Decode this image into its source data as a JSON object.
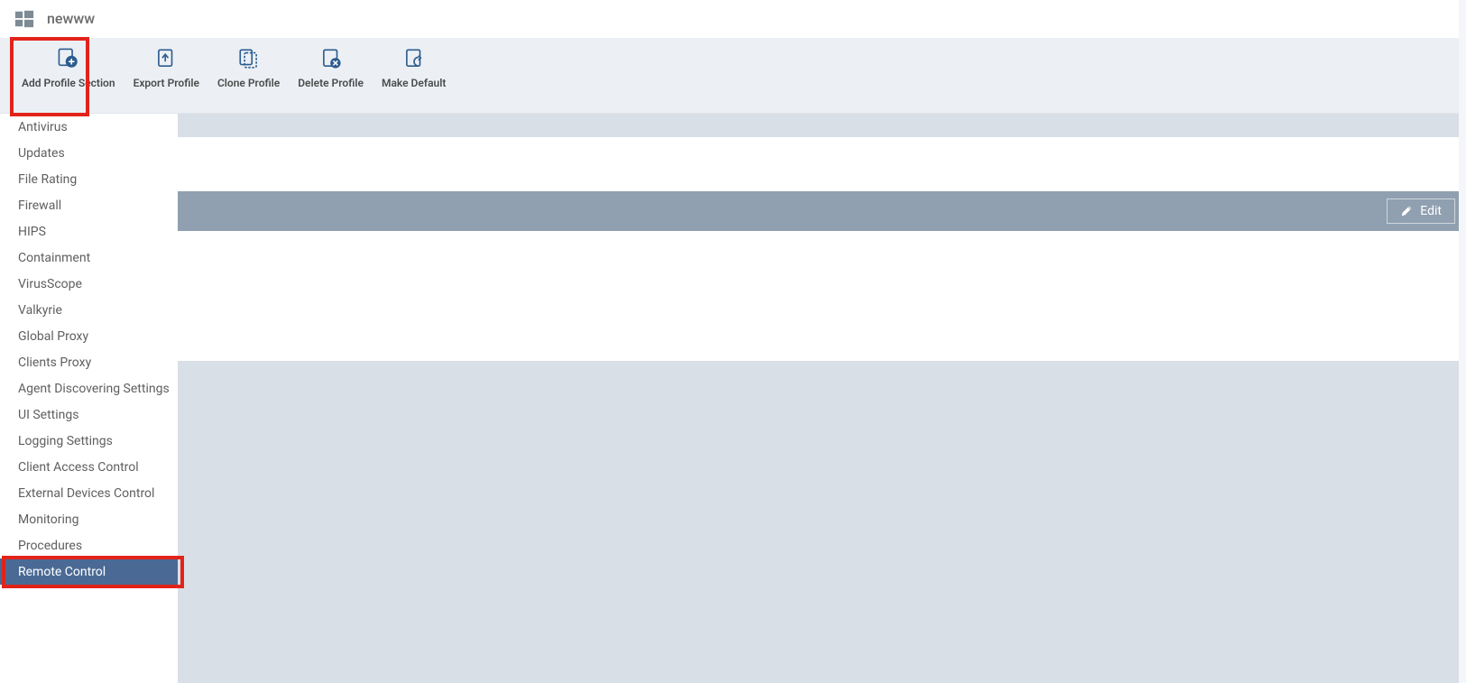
{
  "header": {
    "title": "newww"
  },
  "toolbar": {
    "add_profile_section": "Add Profile Section",
    "export_profile": "Export Profile",
    "clone_profile": "Clone Profile",
    "delete_profile": "Delete Profile",
    "make_default": "Make Default"
  },
  "sidebar": {
    "items": [
      {
        "label": "Antivirus",
        "selected": false
      },
      {
        "label": "Updates",
        "selected": false
      },
      {
        "label": "File Rating",
        "selected": false
      },
      {
        "label": "Firewall",
        "selected": false
      },
      {
        "label": "HIPS",
        "selected": false
      },
      {
        "label": "Containment",
        "selected": false
      },
      {
        "label": "VirusScope",
        "selected": false
      },
      {
        "label": "Valkyrie",
        "selected": false
      },
      {
        "label": "Global Proxy",
        "selected": false
      },
      {
        "label": "Clients Proxy",
        "selected": false
      },
      {
        "label": "Agent Discovering Settings",
        "selected": false
      },
      {
        "label": "UI Settings",
        "selected": false
      },
      {
        "label": "Logging Settings",
        "selected": false
      },
      {
        "label": "Client Access Control",
        "selected": false
      },
      {
        "label": "External Devices Control",
        "selected": false
      },
      {
        "label": "Monitoring",
        "selected": false
      },
      {
        "label": "Procedures",
        "selected": false
      },
      {
        "label": "Remote Control",
        "selected": true
      }
    ]
  },
  "editbar": {
    "edit_label": "Edit"
  },
  "colors": {
    "toolbar_bg": "#ecf0f5",
    "sidebar_selected": "#4a6a95",
    "editbar_bg": "#90a0b0",
    "highlight": "#e2231a"
  }
}
